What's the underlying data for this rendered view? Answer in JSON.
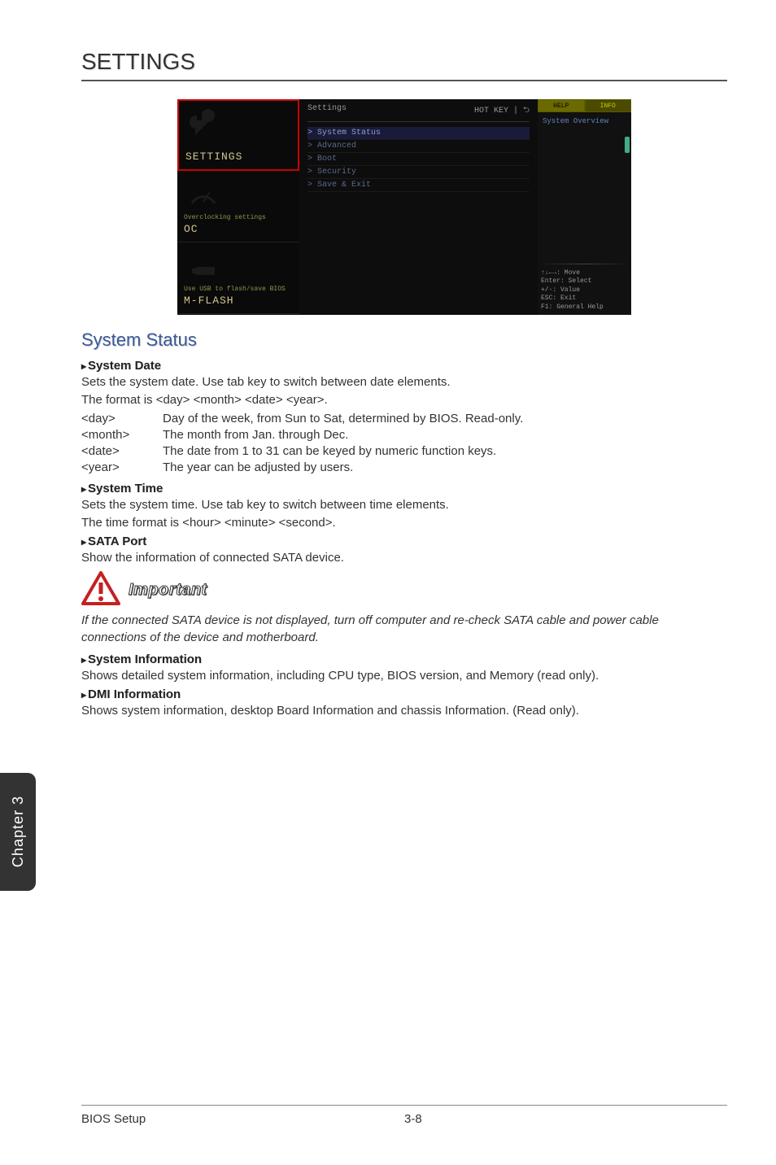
{
  "page_title": "SETTINGS",
  "bios": {
    "sidebar": [
      {
        "subtitle": "",
        "title": "SETTINGS",
        "selected": true
      },
      {
        "subtitle": "Overclocking settings",
        "title": "OC",
        "selected": false
      },
      {
        "subtitle": "Use USB to flash/save BIOS",
        "title": "M-FLASH",
        "selected": false
      }
    ],
    "main_header_left": "Settings",
    "main_header_right": "HOT KEY | ⮌",
    "menu_items": [
      {
        "label": "> System Status",
        "highlighted": true
      },
      {
        "label": "> Advanced",
        "highlighted": false
      },
      {
        "label": "> Boot",
        "highlighted": false
      },
      {
        "label": "> Security",
        "highlighted": false
      },
      {
        "label": "> Save & Exit",
        "highlighted": false
      }
    ],
    "right_tabs": {
      "help": "HELP",
      "info": "INFO"
    },
    "right_help_text": "System Overview",
    "keys": [
      "↑↓←→: Move",
      "Enter: Select",
      "+/-: Value",
      "ESC: Exit",
      "F1: General Help"
    ]
  },
  "section_heading": "System Status",
  "system_date": {
    "heading": "System Date",
    "line1": "Sets the system date. Use tab key to switch between date elements.",
    "line2": "The format is <day> <month> <date> <year>.",
    "rows": [
      {
        "term": "<day>",
        "desc": "Day of the week, from Sun to Sat, determined by BIOS. Read-only."
      },
      {
        "term": "<month>",
        "desc": "The month from Jan. through Dec."
      },
      {
        "term": "<date>",
        "desc": "The date from 1 to 31 can be keyed by numeric function keys."
      },
      {
        "term": "<year>",
        "desc": "The year can be adjusted by users."
      }
    ]
  },
  "system_time": {
    "heading": "System Time",
    "line1": "Sets the system time. Use tab key to switch between time elements.",
    "line2": "The time format is <hour> <minute> <second>."
  },
  "sata_port": {
    "heading": "SATA Port",
    "line1": "Show the information of connected SATA device."
  },
  "important": {
    "label": "Important",
    "note": "If the connected SATA device is not displayed, turn off computer and re-check SATA cable and power cable connections of the device and motherboard."
  },
  "system_info": {
    "heading": "System Information",
    "text": "Shows detailed system information, including CPU type, BIOS version, and Memory (read only)."
  },
  "dmi_info": {
    "heading": "DMI Information",
    "text": "Shows system information, desktop Board Information and chassis Information. (Read only)."
  },
  "chapter_tab": "Chapter 3",
  "footer": {
    "left": "BIOS Setup",
    "page": "3-8"
  }
}
